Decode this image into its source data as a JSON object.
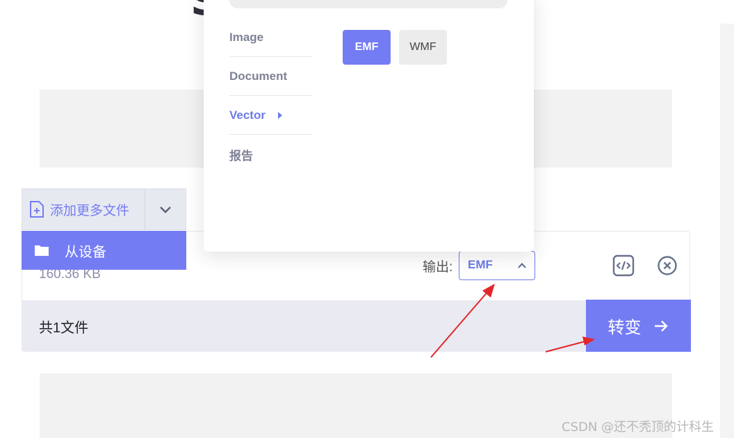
{
  "page": {
    "title_fragment": "S"
  },
  "add_files": {
    "label": "添加更多文件",
    "from_device_label": "从设备"
  },
  "file": {
    "size": "160.36 KB",
    "output_label": "输出:",
    "output_format": "EMF"
  },
  "footer": {
    "file_count": "共1文件",
    "convert_label": "转变"
  },
  "dropdown": {
    "categories": [
      {
        "label": "Image",
        "active": false
      },
      {
        "label": "Document",
        "active": false
      },
      {
        "label": "Vector",
        "active": true
      },
      {
        "label": "报告",
        "active": false
      }
    ],
    "formats": [
      {
        "label": "EMF",
        "selected": true
      },
      {
        "label": "WMF",
        "selected": false
      }
    ]
  },
  "watermark": "CSDN @还不秃顶的计科生",
  "colors": {
    "accent": "#747cf4",
    "arrow": "#e3262a"
  }
}
